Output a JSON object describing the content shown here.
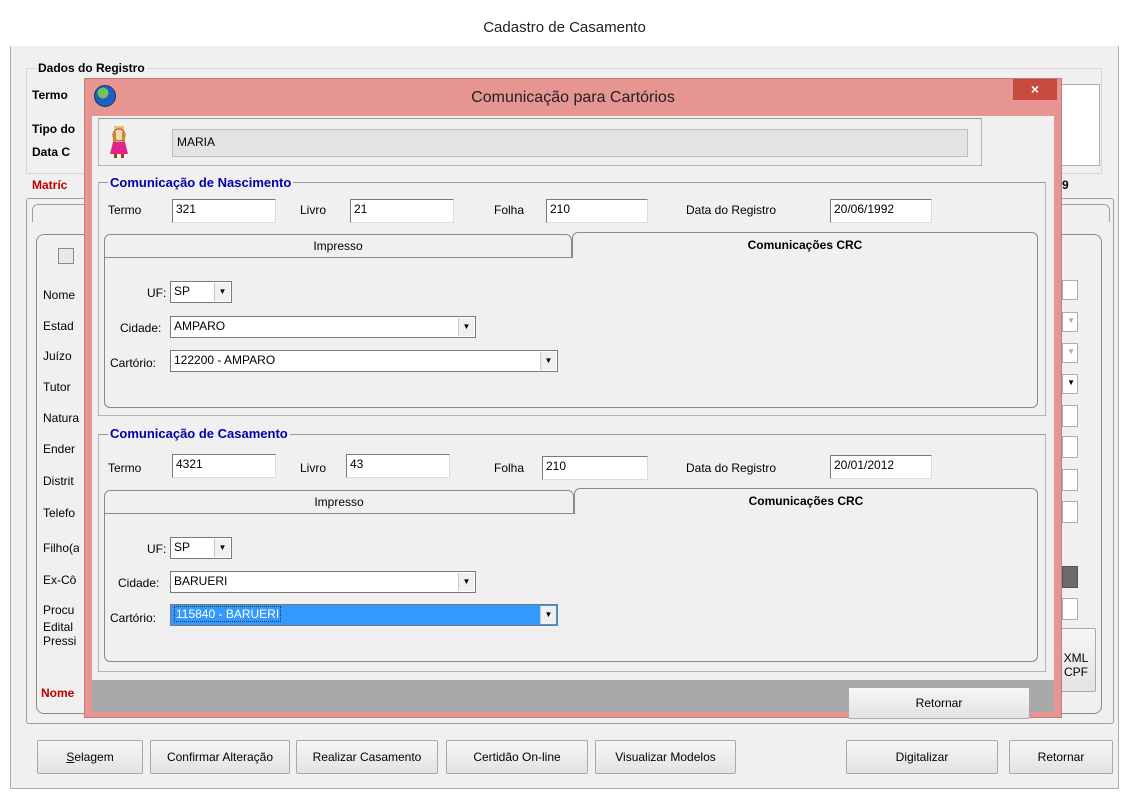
{
  "main_window": {
    "title": "Cadastro de Casamento",
    "registro_legend": "Dados do Registro",
    "left_labels": [
      "Termo",
      "Tipo do",
      "Data C"
    ],
    "matricula_label": "Matríc",
    "matricula_suffix": "9",
    "side_labels": [
      "Nome",
      "Estad",
      "Juízo",
      "Tutor",
      "Natura",
      "Ender",
      "Distrit",
      "Telefo",
      "Filho(a",
      "Ex-Cô",
      "Procu",
      "Edital",
      "Pressi"
    ],
    "nome_bottom_label": "Nome",
    "xml_button_lines": [
      "XML",
      "CPF"
    ],
    "bottom_buttons": [
      {
        "label": "Selagem",
        "accel": "S"
      },
      {
        "label": "Confirmar Alteração",
        "accel": ""
      },
      {
        "label": "Realizar Casamento",
        "accel": "z"
      },
      {
        "label": "Certidão On-line",
        "accel": "O"
      },
      {
        "label": "Visualizar Modelos",
        "accel": "M"
      },
      {
        "label": "Digitalizar",
        "accel": "D"
      },
      {
        "label": "Retornar",
        "accel": "R"
      }
    ]
  },
  "dialog": {
    "title": "Comunicação para Cartórios",
    "close_symbol": "×",
    "person_name": "MARIA",
    "nascimento": {
      "legend": "Comunicação de Nascimento",
      "termo_label": "Termo",
      "termo": "321",
      "livro_label": "Livro",
      "livro": "21",
      "folha_label": "Folha",
      "folha": "210",
      "data_label": "Data do Registro",
      "data": "20/06/1992",
      "tabs": [
        "Impresso",
        "Comunicações CRC"
      ],
      "uf_label": "UF:",
      "uf": "SP",
      "cidade_label": "Cidade:",
      "cidade": "AMPARO",
      "cartorio_label": "Cartório:",
      "cartorio": "122200 - AMPARO"
    },
    "casamento": {
      "legend": "Comunicação de Casamento",
      "termo_label": "Termo",
      "termo": "4321",
      "livro_label": "Livro",
      "livro": "43",
      "folha_label": "Folha",
      "folha": "210",
      "data_label": "Data do Registro",
      "data": "20/01/2012",
      "tabs": [
        "Impresso",
        "Comunicações CRC"
      ],
      "uf_label": "UF:",
      "uf": "SP",
      "cidade_label": "Cidade:",
      "cidade": "BARUERI",
      "cartorio_label": "Cartório:",
      "cartorio": "115840 - BARUERI"
    },
    "retornar_button": "Retornar"
  }
}
